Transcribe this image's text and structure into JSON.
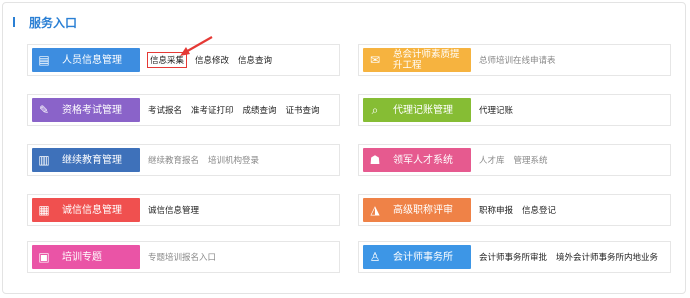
{
  "section": {
    "title": "服务入口"
  },
  "colors": {
    "accent": "#2a7fd4",
    "highlight": "#e53935"
  },
  "cards": [
    {
      "label": "人员信息管理",
      "color": "#3d8de0",
      "icon": "id-card-icon",
      "links": [
        "信息采集",
        "信息修改",
        "信息查询"
      ],
      "muted": false
    },
    {
      "label": "总会计师素质提升工程",
      "color": "#f6b33f",
      "icon": "certificate-icon",
      "links": [
        "总师培训在线申请表"
      ],
      "muted": true
    },
    {
      "label": "资格考试管理",
      "color": "#8a63c9",
      "icon": "pencil-icon",
      "links": [
        "考试报名",
        "准考证打印",
        "成绩查询",
        "证书查询"
      ],
      "muted": false
    },
    {
      "label": "代理记账管理",
      "color": "#86bd34",
      "icon": "search-doc-icon",
      "links": [
        "代理记账"
      ],
      "muted": false
    },
    {
      "label": "继续教育管理",
      "color": "#3e71ba",
      "icon": "book-icon",
      "links": [
        "继续教育报名",
        "培训机构登录"
      ],
      "muted": true
    },
    {
      "label": "领军人才系统",
      "color": "#e65a8f",
      "icon": "people-icon",
      "links": [
        "人才库",
        "管理系统"
      ],
      "muted": true
    },
    {
      "label": "诚信信息管理",
      "color": "#f0504f",
      "icon": "grid-icon",
      "links": [
        "诚信信息管理"
      ],
      "muted": false
    },
    {
      "label": "高级职称评审",
      "color": "#ef8247",
      "icon": "graduate-icon",
      "links": [
        "职称申报",
        "信息登记"
      ],
      "muted": false
    },
    {
      "label": "培训专题",
      "color": "#ea54a6",
      "icon": "presentation-icon",
      "links": [
        "专题培训报名入口"
      ],
      "muted": true
    },
    {
      "label": "会计师事务所",
      "color": "#3d96e6",
      "icon": "person-icon",
      "links": [
        "会计师事务所审批",
        "境外会计师事务所内地业务"
      ],
      "muted": false
    }
  ]
}
